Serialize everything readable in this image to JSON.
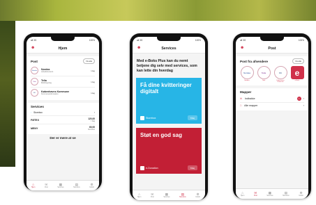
{
  "phone1": {
    "status_time": "14:45",
    "status_right": "100%",
    "status_left": "all 3G",
    "title": "Hjem",
    "post": {
      "title": "Post",
      "see_all": "Vis alle",
      "items": [
        {
          "logo": "Nordea",
          "name": "Nordea",
          "sub": "Lånedokument",
          "date": "I dag"
        },
        {
          "logo": "Telia",
          "name": "Telia",
          "sub": "Mobilregning",
          "date": "I dag"
        },
        {
          "logo": "KK",
          "name": "Københavns Kommune",
          "sub": "Kommuneinformation",
          "date": "I dag"
        }
      ]
    },
    "services": {
      "title": "Services",
      "storebox": "Storebox",
      "items": [
        {
          "name": "FØTEX",
          "amount": "120,00",
          "sub": "I dag"
        },
        {
          "name": "MENY",
          "amount": "60,00",
          "sub": "Storebox"
        }
      ]
    },
    "more": "Der er mere at se",
    "tabs": [
      "Hjem",
      "Post",
      "Services",
      "Storebox",
      "Indstil."
    ]
  },
  "phone2": {
    "status_time": "14:45",
    "status_right": "100%",
    "status_left": "all 3G",
    "title": "Services",
    "intro": "Med e-Boks Plus kan du nemt betjene dig selv med services, som kan lette din hverdag",
    "cards": [
      {
        "title": "Få dine kvitteringer digitalt",
        "brand": "Storebox",
        "button": "Tilføj",
        "color": "#27b5e6"
      },
      {
        "title": "Støt en god sag",
        "brand": "e-Donation",
        "button": "Tilføj",
        "color": "#c21f35"
      }
    ],
    "tabs": [
      "Hjem",
      "Post",
      "Services",
      "Storebox",
      "Indstil."
    ]
  },
  "phone3": {
    "status_time": "14:45",
    "status_right": "100%",
    "status_left": "all 3G",
    "title": "Post",
    "senders": {
      "title": "Post fra afsendere",
      "see_all": "Vis alle",
      "items": [
        {
          "logo": "Nordea",
          "name": "Nordea"
        },
        {
          "logo": "Telia",
          "name": "Telia"
        },
        {
          "logo": "KK",
          "name": "Københavns Kommune"
        },
        {
          "logo": "e",
          "name": "e-Boks"
        }
      ]
    },
    "folders": {
      "title": "Mapper",
      "inbox": "Indbakke",
      "inbox_count": "1",
      "all": "Alle mapper"
    },
    "tabs": [
      "Hjem",
      "Post",
      "Services",
      "Storebox",
      "Indstil."
    ]
  },
  "colors": {
    "accent": "#d0314a",
    "storebox": "#27b5e6",
    "donation": "#c21f35"
  }
}
